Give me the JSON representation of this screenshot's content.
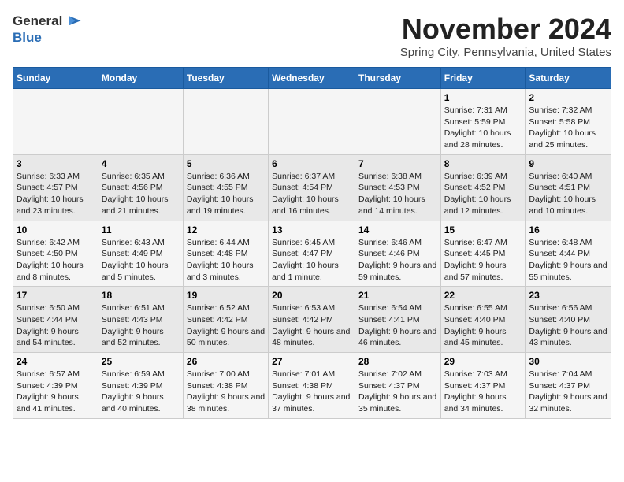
{
  "header": {
    "logo_general": "General",
    "logo_blue": "Blue",
    "month_title": "November 2024",
    "subtitle": "Spring City, Pennsylvania, United States"
  },
  "days_of_week": [
    "Sunday",
    "Monday",
    "Tuesday",
    "Wednesday",
    "Thursday",
    "Friday",
    "Saturday"
  ],
  "weeks": [
    [
      {
        "day": "",
        "info": ""
      },
      {
        "day": "",
        "info": ""
      },
      {
        "day": "",
        "info": ""
      },
      {
        "day": "",
        "info": ""
      },
      {
        "day": "",
        "info": ""
      },
      {
        "day": "1",
        "info": "Sunrise: 7:31 AM\nSunset: 5:59 PM\nDaylight: 10 hours and 28 minutes."
      },
      {
        "day": "2",
        "info": "Sunrise: 7:32 AM\nSunset: 5:58 PM\nDaylight: 10 hours and 25 minutes."
      }
    ],
    [
      {
        "day": "3",
        "info": "Sunrise: 6:33 AM\nSunset: 4:57 PM\nDaylight: 10 hours and 23 minutes."
      },
      {
        "day": "4",
        "info": "Sunrise: 6:35 AM\nSunset: 4:56 PM\nDaylight: 10 hours and 21 minutes."
      },
      {
        "day": "5",
        "info": "Sunrise: 6:36 AM\nSunset: 4:55 PM\nDaylight: 10 hours and 19 minutes."
      },
      {
        "day": "6",
        "info": "Sunrise: 6:37 AM\nSunset: 4:54 PM\nDaylight: 10 hours and 16 minutes."
      },
      {
        "day": "7",
        "info": "Sunrise: 6:38 AM\nSunset: 4:53 PM\nDaylight: 10 hours and 14 minutes."
      },
      {
        "day": "8",
        "info": "Sunrise: 6:39 AM\nSunset: 4:52 PM\nDaylight: 10 hours and 12 minutes."
      },
      {
        "day": "9",
        "info": "Sunrise: 6:40 AM\nSunset: 4:51 PM\nDaylight: 10 hours and 10 minutes."
      }
    ],
    [
      {
        "day": "10",
        "info": "Sunrise: 6:42 AM\nSunset: 4:50 PM\nDaylight: 10 hours and 8 minutes."
      },
      {
        "day": "11",
        "info": "Sunrise: 6:43 AM\nSunset: 4:49 PM\nDaylight: 10 hours and 5 minutes."
      },
      {
        "day": "12",
        "info": "Sunrise: 6:44 AM\nSunset: 4:48 PM\nDaylight: 10 hours and 3 minutes."
      },
      {
        "day": "13",
        "info": "Sunrise: 6:45 AM\nSunset: 4:47 PM\nDaylight: 10 hours and 1 minute."
      },
      {
        "day": "14",
        "info": "Sunrise: 6:46 AM\nSunset: 4:46 PM\nDaylight: 9 hours and 59 minutes."
      },
      {
        "day": "15",
        "info": "Sunrise: 6:47 AM\nSunset: 4:45 PM\nDaylight: 9 hours and 57 minutes."
      },
      {
        "day": "16",
        "info": "Sunrise: 6:48 AM\nSunset: 4:44 PM\nDaylight: 9 hours and 55 minutes."
      }
    ],
    [
      {
        "day": "17",
        "info": "Sunrise: 6:50 AM\nSunset: 4:44 PM\nDaylight: 9 hours and 54 minutes."
      },
      {
        "day": "18",
        "info": "Sunrise: 6:51 AM\nSunset: 4:43 PM\nDaylight: 9 hours and 52 minutes."
      },
      {
        "day": "19",
        "info": "Sunrise: 6:52 AM\nSunset: 4:42 PM\nDaylight: 9 hours and 50 minutes."
      },
      {
        "day": "20",
        "info": "Sunrise: 6:53 AM\nSunset: 4:42 PM\nDaylight: 9 hours and 48 minutes."
      },
      {
        "day": "21",
        "info": "Sunrise: 6:54 AM\nSunset: 4:41 PM\nDaylight: 9 hours and 46 minutes."
      },
      {
        "day": "22",
        "info": "Sunrise: 6:55 AM\nSunset: 4:40 PM\nDaylight: 9 hours and 45 minutes."
      },
      {
        "day": "23",
        "info": "Sunrise: 6:56 AM\nSunset: 4:40 PM\nDaylight: 9 hours and 43 minutes."
      }
    ],
    [
      {
        "day": "24",
        "info": "Sunrise: 6:57 AM\nSunset: 4:39 PM\nDaylight: 9 hours and 41 minutes."
      },
      {
        "day": "25",
        "info": "Sunrise: 6:59 AM\nSunset: 4:39 PM\nDaylight: 9 hours and 40 minutes."
      },
      {
        "day": "26",
        "info": "Sunrise: 7:00 AM\nSunset: 4:38 PM\nDaylight: 9 hours and 38 minutes."
      },
      {
        "day": "27",
        "info": "Sunrise: 7:01 AM\nSunset: 4:38 PM\nDaylight: 9 hours and 37 minutes."
      },
      {
        "day": "28",
        "info": "Sunrise: 7:02 AM\nSunset: 4:37 PM\nDaylight: 9 hours and 35 minutes."
      },
      {
        "day": "29",
        "info": "Sunrise: 7:03 AM\nSunset: 4:37 PM\nDaylight: 9 hours and 34 minutes."
      },
      {
        "day": "30",
        "info": "Sunrise: 7:04 AM\nSunset: 4:37 PM\nDaylight: 9 hours and 32 minutes."
      }
    ]
  ]
}
